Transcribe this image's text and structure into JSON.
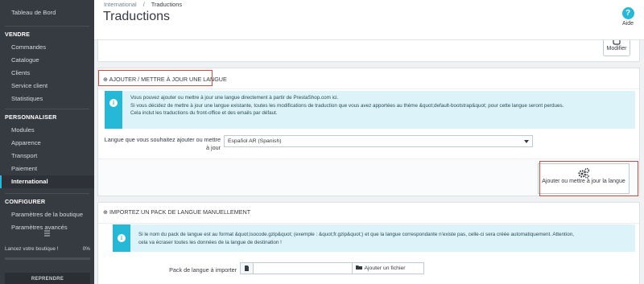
{
  "sidebar": {
    "dashboard": "Tableau de Bord",
    "sections": [
      {
        "title": "VENDRE",
        "items": [
          "Commandes",
          "Catalogue",
          "Clients",
          "Service client",
          "Statistiques"
        ]
      },
      {
        "title": "PERSONNALISER",
        "items": [
          "Modules",
          "Apparence",
          "Transport",
          "Paiement",
          "International"
        ]
      },
      {
        "title": "CONFIGURER",
        "items": [
          "Paramètres de la boutique",
          "Paramètres avancés"
        ]
      }
    ],
    "active_item": "International",
    "launch_label": "Lancez votre boutique !",
    "launch_percent": "0%",
    "launch_progress": 0,
    "resume_button": "REPRENDRE"
  },
  "header": {
    "breadcrumb_parent": "International",
    "breadcrumb_separator": "/",
    "breadcrumb_current": "Traductions",
    "title": "Traductions",
    "help_label": "Aide",
    "help_icon": "?"
  },
  "top_panel": {
    "modify_button": "Modifier"
  },
  "add_language": {
    "heading": "AJOUTER / METTRE À JOUR UNE LANGUE",
    "alert_lines": [
      "Vous pouvez ajouter ou mettre à jour une langue directement à partir de PrestaShop.com ici.",
      "Si vous décidez de mettre à jour une langue existante, toutes les modifications de traduction que vous avez apportées au thème &quot;default-bootstrap&quot; pour cette langue seront perdues.",
      "Cela inclut les traductions du front-office et des emails par défaut."
    ],
    "select_label_line1": "Langue que vous souhaitez ajouter ou mettre",
    "select_label_line2": "à jour",
    "selected_language": "Español AR (Spanish)",
    "submit_button": "Ajouter ou mettre à jour la langue",
    "highlight_color": "#d9463a"
  },
  "import_pack": {
    "heading": "IMPORTEZ UN PACK DE LANGUE MANUELLEMENT",
    "alert_lines": [
      "Si le nom du pack de langue est au format &quot;isocode.gzip&quot; (exemple : &quot;fr.gzip&quot;) et que la langue correspondante n'existe pas, celle-ci sera créée automatiquement. Attention,",
      "cela va écraser toutes les données de la langue de destination !"
    ],
    "file_label": "Pack de langue à importer",
    "file_value": "",
    "add_file_button": "Ajouter un fichier"
  },
  "colors": {
    "accent": "#25b9d7",
    "sidebar_bg": "#363a41",
    "info_bg": "#dcf4f9"
  }
}
